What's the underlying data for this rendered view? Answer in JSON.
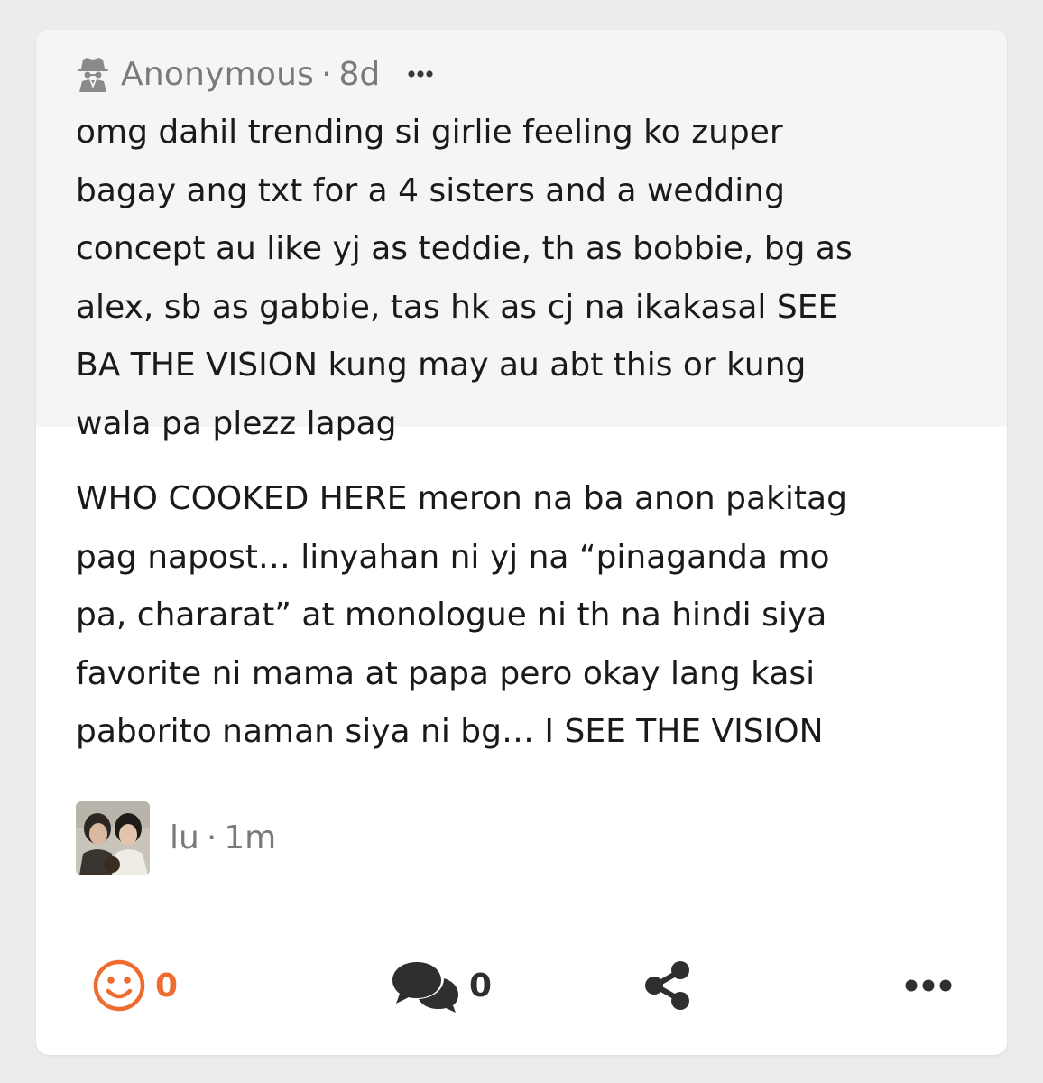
{
  "post": {
    "author": "Anonymous",
    "separator": "·",
    "time": "8d",
    "text": "omg dahil trending si girlie feeling ko zuper\nbagay ang txt for a 4 sisters and a wedding\nconcept au like yj as teddie, th as bobbie, bg as\nalex, sb as gabbie, tas hk as cj na ikakasal SEE\nBA THE VISION kung may au abt this or kung\nwala pa plezz lapag",
    "icons": {
      "author_icon": "anonymous-spy-icon",
      "more_icon": "more-horizontal-icon"
    }
  },
  "reply": {
    "text": "WHO COOKED HERE meron na ba anon pakitag\npag napost… linyahan ni yj na “pinaganda mo\npa, chararat” at monologue ni th na hindi siya\nfavorite ni mama at papa pero okay lang kasi\npaborito naman siya ni bg… I SEE THE VISION",
    "author": "lu",
    "separator": "·",
    "time": "1m"
  },
  "actions": {
    "react_count": "0",
    "comment_count": "0",
    "icons": {
      "react": "smiley-icon",
      "comment": "comments-icon",
      "share": "share-icon",
      "more": "more-horizontal-icon"
    }
  },
  "colors": {
    "accent": "#ef6c2f",
    "meta_text": "#7a7a7a",
    "body_text": "#1a1a1a",
    "quoted_bg": "#f5f5f5",
    "page_bg": "#ececee"
  }
}
